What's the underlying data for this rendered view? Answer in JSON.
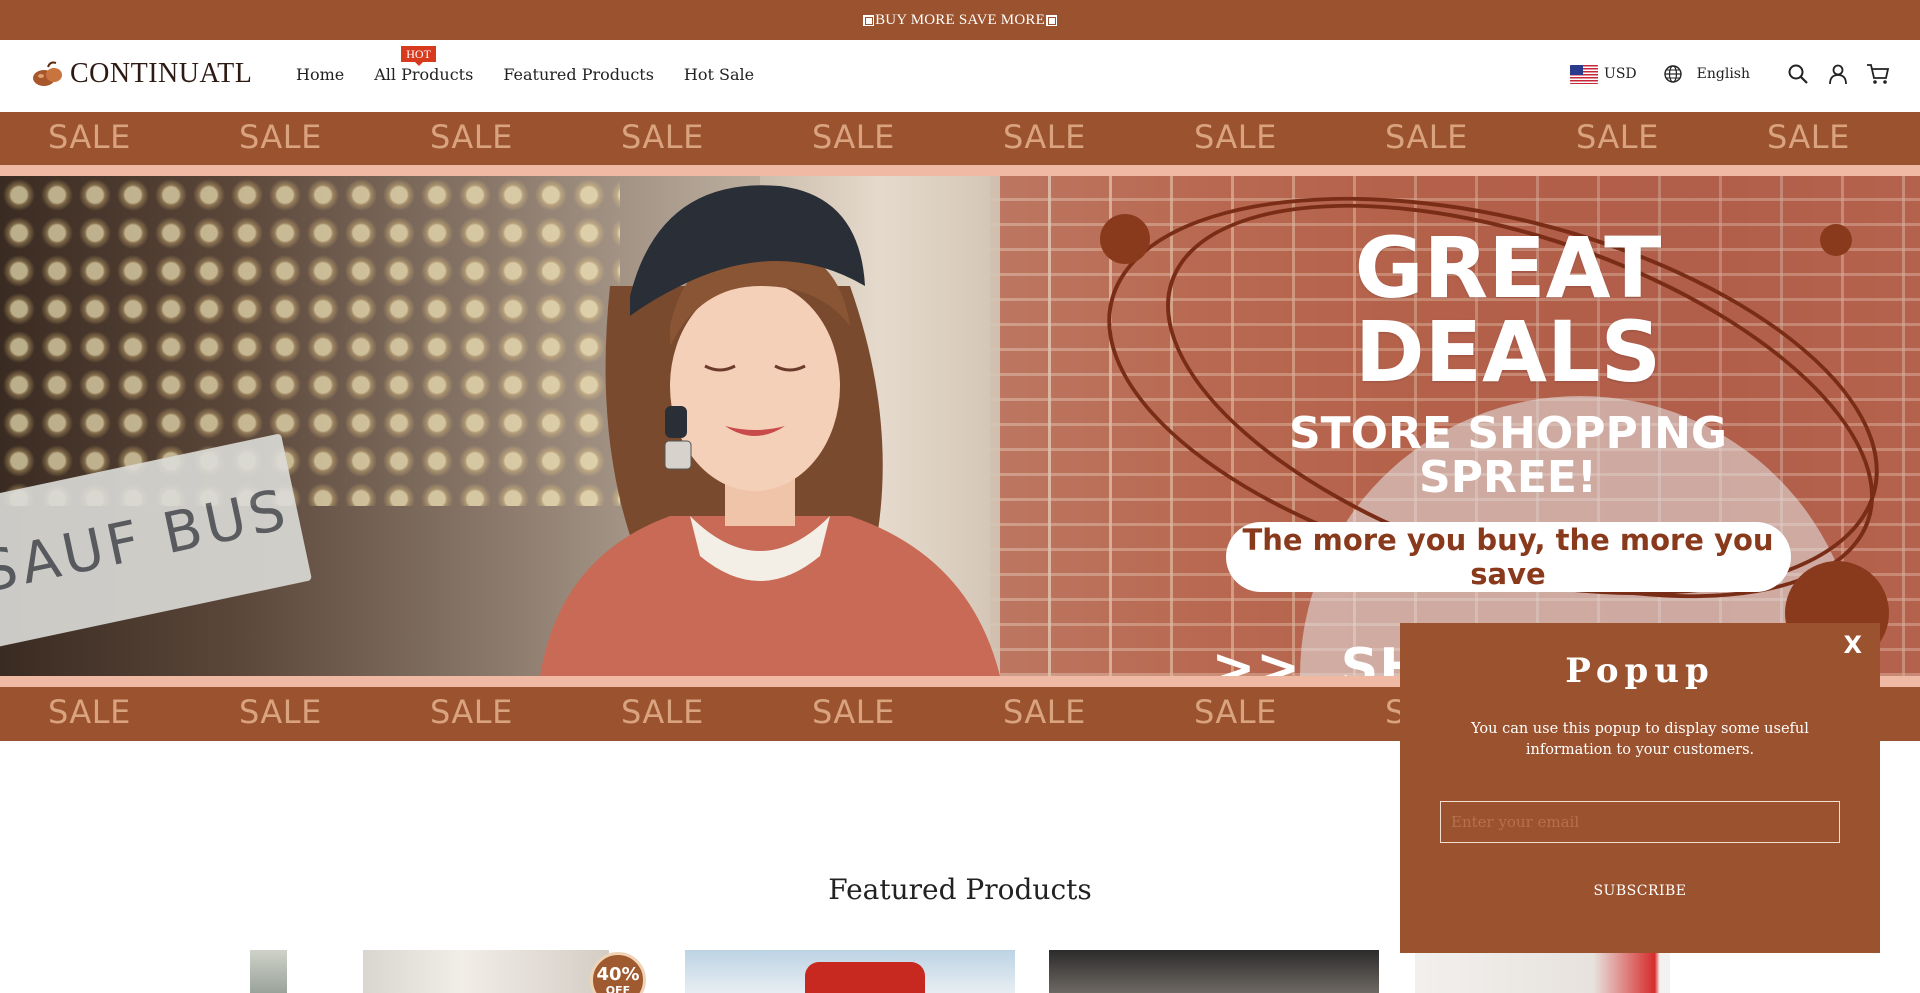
{
  "announcement": {
    "text": "BUY MORE SAVE MORE"
  },
  "header": {
    "logo_text": "CONTINUATL",
    "nav": [
      {
        "label": "Home"
      },
      {
        "label": "All Products",
        "badge": "HOT"
      },
      {
        "label": "Featured Products"
      },
      {
        "label": "Hot Sale"
      }
    ],
    "currency": "USD",
    "language": "English",
    "icons": [
      "globe-icon",
      "search-icon",
      "account-icon",
      "cart-icon"
    ]
  },
  "sale_strip": {
    "word": "SALE"
  },
  "hero": {
    "title": "GREAT DEALS",
    "subtitle": "STORE SHOPPING SPREE!",
    "pill_text": "The more you buy, the more you save",
    "cta_arrows": ">>",
    "cta_label": "SHOP NOW",
    "sign_text": "SAUF BUS"
  },
  "featured": {
    "title": "Featured Products",
    "discount_badge": {
      "value": "40%",
      "suffix": "OFF"
    }
  },
  "popup": {
    "close_label": "X",
    "title": "Popup",
    "text": "You can use this popup to display some useful information to your customers.",
    "email_placeholder": "Enter your email",
    "subscribe_label": "SUBSCRIBE"
  },
  "colors": {
    "brand": "#9b522e",
    "hot_badge": "#d83a1e",
    "sale_text": "#d9a37f",
    "pink_band": "#efb9a4",
    "hero_accent": "#8a3a1c"
  }
}
